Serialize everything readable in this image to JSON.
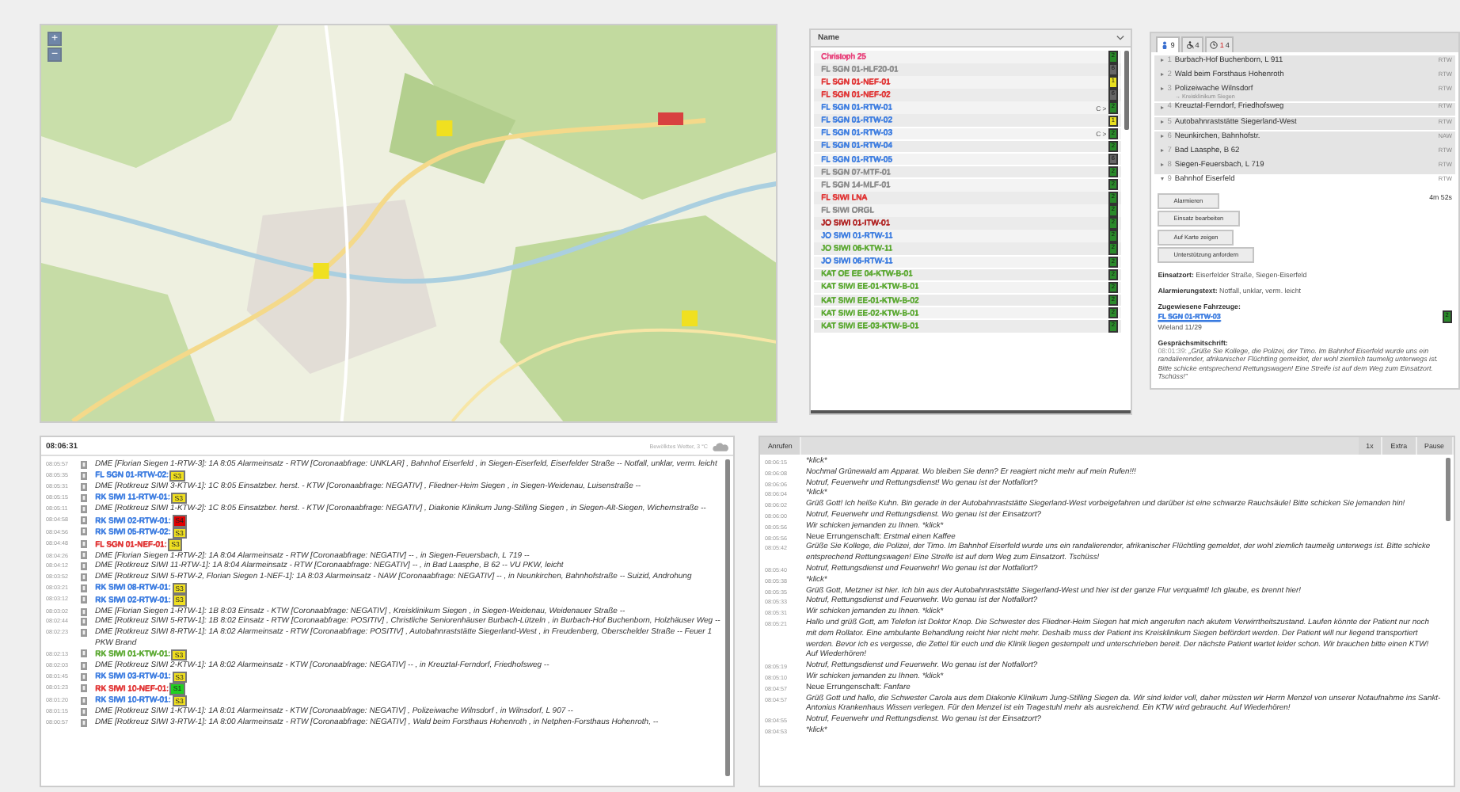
{
  "map": {
    "zoom_in": "+",
    "zoom_out": "−"
  },
  "vehicles": {
    "column": "Name",
    "items": [
      {
        "name": "Christoph 25",
        "color": "#e8407a",
        "status": {
          "text": "2",
          "color": "#2a8a2a"
        }
      },
      {
        "name": "FL SGN 01-HLF20-01",
        "color": "#8a8a8a",
        "status": {
          "text": "6",
          "color": "#666666"
        }
      },
      {
        "name": "FL SGN 01-NEF-01",
        "color": "#e03030",
        "status": {
          "text": "1",
          "color": "#e8e020"
        }
      },
      {
        "name": "FL SGN 01-NEF-02",
        "color": "#e03030",
        "status": {
          "text": "6",
          "color": "#666666"
        }
      },
      {
        "name": "FL SGN 01-RTW-01",
        "color": "#3a7be0",
        "marker": "C >",
        "status": {
          "text": "2",
          "color": "#2a8a2a"
        }
      },
      {
        "name": "FL SGN 01-RTW-02",
        "color": "#3a7be0",
        "status": {
          "text": "1",
          "color": "#e8e020"
        }
      },
      {
        "name": "FL SGN 01-RTW-03",
        "color": "#3a7be0",
        "marker": "C >",
        "status": {
          "text": "2",
          "color": "#2a8a2a"
        }
      },
      {
        "name": "FL SGN 01-RTW-04",
        "color": "#3a7be0",
        "status": {
          "text": "2",
          "color": "#2a8a2a"
        }
      },
      {
        "name": "FL SGN 01-RTW-05",
        "color": "#3a7be0",
        "status": {
          "text": "6",
          "color": "#666666"
        }
      },
      {
        "name": "FL SGN 07-MTF-01",
        "color": "#8a8a8a",
        "status": {
          "text": "2",
          "color": "#2a8a2a"
        }
      },
      {
        "name": "FL SGN 14-MLF-01",
        "color": "#8a8a8a",
        "status": {
          "text": "2",
          "color": "#2a8a2a"
        }
      },
      {
        "name": "FL SIWI LNA",
        "color": "#e03030",
        "status": {
          "text": "2",
          "color": "#2a8a2a"
        }
      },
      {
        "name": "FL SIWI ORGL",
        "color": "#8a8a8a",
        "status": {
          "text": "2",
          "color": "#2a8a2a"
        }
      },
      {
        "name": "JO SIWI 01-ITW-01",
        "color": "#b02020",
        "status": {
          "text": "2",
          "color": "#2a8a2a"
        }
      },
      {
        "name": "JO SIWI 01-RTW-11",
        "color": "#3a7be0",
        "status": {
          "text": "2",
          "color": "#2a8a2a"
        }
      },
      {
        "name": "JO SIWI 06-KTW-11",
        "color": "#5aa830",
        "status": {
          "text": "2",
          "color": "#2a8a2a"
        }
      },
      {
        "name": "JO SIWI 06-RTW-11",
        "color": "#3a7be0",
        "status": {
          "text": "2",
          "color": "#2a8a2a"
        }
      },
      {
        "name": "KAT OE EE 04-KTW-B-01",
        "color": "#5aa830",
        "status": {
          "text": "2",
          "color": "#2a8a2a"
        }
      },
      {
        "name": "KAT SIWI EE-01-KTW-B-01",
        "color": "#5aa830",
        "status": {
          "text": "2",
          "color": "#2a8a2a"
        }
      },
      {
        "name": "KAT SIWI EE-01-KTW-B-02",
        "color": "#5aa830",
        "status": {
          "text": "2",
          "color": "#2a8a2a"
        }
      },
      {
        "name": "KAT SIWI EE-02-KTW-B-01",
        "color": "#5aa830",
        "status": {
          "text": "2",
          "color": "#2a8a2a"
        }
      },
      {
        "name": "KAT SIWI EE-03-KTW-B-01",
        "color": "#5aa830",
        "status": {
          "text": "2",
          "color": "#2a8a2a"
        }
      }
    ]
  },
  "incidents": {
    "tabs": [
      {
        "kind": "calls",
        "label": "9",
        "selected": true
      },
      {
        "kind": "vehicles",
        "label": "4",
        "selected": false
      },
      {
        "kind": "timer",
        "label": "1",
        "label_2": "4",
        "selected": false
      }
    ],
    "items": [
      {
        "number": "1",
        "title": "Burbach-Hof Buchenborn, L 911",
        "type": "RTW",
        "expanded": false
      },
      {
        "number": "2",
        "title": "Wald beim Forsthaus Hohenroth",
        "type": "RTW",
        "expanded": false
      },
      {
        "number": "3",
        "title": "Polizeiwache Wilnsdorf",
        "subtitle": "→ Kreisklinikum Siegen",
        "type": "RTW",
        "expanded": false
      },
      {
        "number": "4",
        "title": "Kreuztal-Ferndorf, Friedhofsweg",
        "type": "RTW",
        "expanded": false
      },
      {
        "number": "5",
        "title": "Autobahnraststätte Siegerland-West",
        "type": "RTW",
        "expanded": false
      },
      {
        "number": "6",
        "title": "Neunkirchen, Bahnhofstr.",
        "type": "NAW",
        "expanded": false
      },
      {
        "number": "7",
        "title": "Bad Laasphe, B 62",
        "type": "RTW",
        "expanded": false
      },
      {
        "number": "8",
        "title": "Siegen-Feuersbach, L 719",
        "type": "RTW",
        "expanded": false
      },
      {
        "number": "9",
        "title": "Bahnhof Eiserfeld",
        "type": "RTW",
        "expanded": true
      }
    ],
    "detail": {
      "buttons": [
        "Alarmieren",
        "Einsatz bearbeiten",
        "Auf Karte zeigen",
        "Unterstützung anfordern"
      ],
      "timer": "4m 52s",
      "location_label": "Einsatzort:",
      "location": "Eiserfelder Straße, Siegen-Eiserfeld",
      "alarm_label": "Alarmierungstext:",
      "alarm": "Notfall, unklar, verm. leicht",
      "vehicles_label": "Zugewiesene Fahrzeuge:",
      "vehicle": {
        "name": "FL SGN 01-RTW-03",
        "color": "#3a7be0",
        "status": {
          "text": "2",
          "color": "#2a8a2a"
        }
      },
      "vehicle_note": "Wieland 11/29",
      "transcript_label": "Gesprächsmitschrift:",
      "transcript_time": "08:01:39:",
      "transcript": "„Grüße Sie Kollege, die Polizei, der Timo. Im Bahnhof Eiserfeld wurde uns ein randalierender, afrikanischer Flüchtling gemeldet, der wohl ziemlich taumelig unterwegs ist. Bitte schicke entsprechend Rettungswagen! Eine Streife ist auf dem Weg zum Einsatzort. Tschüss!\""
    }
  },
  "radio_log": {
    "time": "08:06:31",
    "weather": "Bewölktes Wetter, 3 °C",
    "entries": [
      {
        "time": "08:05:57",
        "kind": "dme",
        "text": "DME [Florian Siegen 1-RTW-3]: 1A 8:05 Alarmeinsatz - RTW [Coronaabfrage: UNKLAR] , Bahnhof Eiserfeld , in Siegen-Eiserfeld, Eiserfelder Straße -- Notfall, unklar, verm. leicht"
      },
      {
        "time": "08:05:35",
        "kind": "status",
        "vehicle": "FL SGN 01-RTW-02:",
        "color": "#3a7be0",
        "status": {
          "text": "S3",
          "color": "#f0e020"
        }
      },
      {
        "time": "08:05:31",
        "kind": "dme",
        "text": "DME [Rotkreuz SIWI 3-KTW-1]: 1C 8:05 Einsatzber. herst. - KTW [Coronaabfrage: NEGATIV] , Fliedner-Heim Siegen , in Siegen-Weidenau, Luisenstraße --"
      },
      {
        "time": "08:05:15",
        "kind": "status",
        "vehicle": "RK SIWI 11-RTW-01:",
        "color": "#3a7be0",
        "status": {
          "text": "S3",
          "color": "#f0e020"
        }
      },
      {
        "time": "08:05:11",
        "kind": "dme",
        "text": "DME [Rotkreuz SIWI 1-KTW-2]: 1C 8:05 Einsatzber. herst. - KTW [Coronaabfrage: NEGATIV] , Diakonie Klinikum Jung-Stilling Siegen , in Siegen-Alt-Siegen, Wichernstraße --"
      },
      {
        "time": "08:04:58",
        "kind": "status",
        "vehicle": "RK SIWI 02-RTW-01:",
        "color": "#3a7be0",
        "status": {
          "text": "S4",
          "color": "#e00000"
        }
      },
      {
        "time": "08:04:56",
        "kind": "status",
        "vehicle": "RK SIWI 05-RTW-02:",
        "color": "#3a7be0",
        "status": {
          "text": "S3",
          "color": "#f0e020"
        }
      },
      {
        "time": "08:04:48",
        "kind": "status",
        "vehicle": "FL SGN 01-NEF-01:",
        "color": "#e03030",
        "status": {
          "text": "S3",
          "color": "#f0e020"
        }
      },
      {
        "time": "08:04:26",
        "kind": "dme",
        "text": "DME [Florian Siegen 1-RTW-2]: 1A 8:04 Alarmeinsatz - RTW [Coronaabfrage: NEGATIV] -- , in Siegen-Feuersbach, L 719 --"
      },
      {
        "time": "08:04:12",
        "kind": "dme",
        "text": "DME [Rotkreuz SIWI 11-RTW-1]: 1A 8:04 Alarmeinsatz - RTW [Coronaabfrage: NEGATIV] -- , in Bad Laasphe, B 62 -- VU PKW, leicht"
      },
      {
        "time": "08:03:52",
        "kind": "dme",
        "text": "DME [Rotkreuz SIWI 5-RTW-2, Florian Siegen 1-NEF-1]: 1A 8:03 Alarmeinsatz - NAW [Coronaabfrage: NEGATIV] -- , in Neunkirchen, Bahnhofstraße -- Suizid, Androhung"
      },
      {
        "time": "08:03:21",
        "kind": "status",
        "vehicle": "RK SIWI 08-RTW-01:",
        "color": "#3a7be0",
        "status": {
          "text": "S3",
          "color": "#f0e020"
        }
      },
      {
        "time": "08:03:12",
        "kind": "status",
        "vehicle": "RK SIWI 02-RTW-01:",
        "color": "#3a7be0",
        "status": {
          "text": "S3",
          "color": "#f0e020"
        }
      },
      {
        "time": "08:03:02",
        "kind": "dme",
        "text": "DME [Florian Siegen 1-RTW-1]: 1B 8:03 Einsatz - KTW [Coronaabfrage: NEGATIV] , Kreisklinikum Siegen , in Siegen-Weidenau, Weidenauer Straße --"
      },
      {
        "time": "08:02:44",
        "kind": "dme",
        "text": "DME [Rotkreuz SIWI 5-RTW-1]: 1B 8:02 Einsatz - RTW [Coronaabfrage: POSITIV] , Christliche Seniorenhäuser Burbach-Lützeln , in Burbach-Hof Buchenborn, Holzhäuser Weg --"
      },
      {
        "time": "08:02:23",
        "kind": "dme",
        "text": "DME [Rotkreuz SIWI 8-RTW-1]: 1A 8:02 Alarmeinsatz - RTW [Coronaabfrage: POSITIV] , Autobahnraststätte Siegerland-West , in Freudenberg, Oberschelder Straße -- Feuer 1 PKW Brand"
      },
      {
        "time": "08:02:13",
        "kind": "status",
        "vehicle": "RK SIWI 01-KTW-01:",
        "color": "#5aa830",
        "status": {
          "text": "S3",
          "color": "#f0e020"
        }
      },
      {
        "time": "08:02:03",
        "kind": "dme",
        "text": "DME [Rotkreuz SIWI 2-KTW-1]: 1A 8:02 Alarmeinsatz - KTW [Coronaabfrage: NEGATIV] -- , in Kreuztal-Ferndorf, Friedhofsweg --"
      },
      {
        "time": "08:01:45",
        "kind": "status",
        "vehicle": "RK SIWI 03-RTW-01:",
        "color": "#3a7be0",
        "status": {
          "text": "S3",
          "color": "#f0e020"
        }
      },
      {
        "time": "08:01:23",
        "kind": "status",
        "vehicle": "RK SIWI 10-NEF-01:",
        "color": "#e03030",
        "status": {
          "text": "S1",
          "color": "#20d020"
        }
      },
      {
        "time": "08:01:20",
        "kind": "status",
        "vehicle": "RK SIWI 10-RTW-01:",
        "color": "#3a7be0",
        "status": {
          "text": "S3",
          "color": "#f0e020"
        }
      },
      {
        "time": "08:01:15",
        "kind": "dme",
        "text": "DME [Rotkreuz SIWI 1-KTW-1]: 1A 8:01 Alarmeinsatz - KTW [Coronaabfrage: NEGATIV] , Polizeiwache Wilnsdorf , in Wilnsdorf, L 907 --"
      },
      {
        "time": "08:00:57",
        "kind": "dme",
        "text": "DME [Rotkreuz SIWI 3-RTW-1]: 1A 8:00 Alarmeinsatz - RTW [Coronaabfrage: NEGATIV] , Wald beim Forsthaus Hohenroth , in Netphen-Forsthaus Hohenroth, --"
      }
    ]
  },
  "call_log": {
    "call_button": "Anrufen",
    "speed_buttons": [
      "1x",
      "Extra",
      "Pause"
    ],
    "entries": [
      {
        "time": "08:06:15",
        "kind": "call",
        "text": "*klick*"
      },
      {
        "time": "08:06:08",
        "kind": "call",
        "text": "Nochmal Grünewald am Apparat. Wo bleiben Sie denn? Er reagiert nicht mehr auf mein Rufen!!!"
      },
      {
        "time": "08:06:06",
        "kind": "call",
        "text": "Notruf, Feuerwehr und Rettungsdienst! Wo genau ist der Notfallort?"
      },
      {
        "time": "08:06:04",
        "kind": "call",
        "text": "*klick*"
      },
      {
        "time": "08:06:02",
        "kind": "call",
        "text": "Grüß Gott! Ich heiße Kuhn. Bin gerade in der Autobahnraststätte Siegerland-West vorbeigefahren und darüber ist eine schwarze Rauchsäule! Bitte schicken Sie jemanden hin!"
      },
      {
        "time": "08:06:00",
        "kind": "call",
        "text": "Notruf, Feuerwehr und Rettungsdienst. Wo genau ist der Einsatzort?"
      },
      {
        "time": "08:05:56",
        "kind": "call",
        "text": "Wir schicken jemanden zu Ihnen. *klick*"
      },
      {
        "time": "08:05:56",
        "kind": "achievement",
        "text": "Neue Errungenschaft: *Erstmal einen Kaffee*"
      },
      {
        "time": "08:05:42",
        "kind": "call",
        "text": "Grüße Sie Kollege, die Polizei, der Timo. Im Bahnhof Eiserfeld wurde uns ein randalierender, afrikanischer Flüchtling gemeldet, der wohl ziemlich taumelig unterwegs ist. Bitte schicke entsprechend Rettungswagen! Eine Streife ist auf dem Weg zum Einsatzort. Tschüss!"
      },
      {
        "time": "08:05:40",
        "kind": "call",
        "text": "Notruf, Rettungsdienst und Feuerwehr! Wo genau ist der Notfallort?"
      },
      {
        "time": "08:05:38",
        "kind": "call",
        "text": "*klick*"
      },
      {
        "time": "08:05:35",
        "kind": "call",
        "text": "Grüß Gott, Metzner ist hier. Ich bin aus der Autobahnraststätte Siegerland-West und hier ist der ganze Flur verqualmt! Ich glaube, es brennt hier!"
      },
      {
        "time": "08:05:33",
        "kind": "call",
        "text": "Notruf, Rettungsdienst und Feuerwehr. Wo genau ist der Notfallort?"
      },
      {
        "time": "08:05:31",
        "kind": "call",
        "text": "Wir schicken jemanden zu Ihnen. *klick*"
      },
      {
        "time": "08:05:21",
        "kind": "call",
        "text": "Hallo und grüß Gott, am Telefon ist Doktor Knop. Die Schwester des Fliedner-Heim Siegen hat mich angerufen nach akutem Verwirrtheitszustand. Laufen könnte der Patient nur noch mit dem Rollator. Eine ambulante Behandlung reicht hier nicht mehr. Deshalb muss der Patient ins Kreisklinikum Siegen befördert werden. Der Patient will nur liegend transportiert werden. Bevor ich es vergesse, die Zettel für euch und die Klinik liegen gestempelt und unterschrieben bereit. Der nächste Patient wartet leider schon. Wir brauchen bitte einen KTW! Auf Wiederhören!"
      },
      {
        "time": "08:05:19",
        "kind": "call",
        "text": "Notruf, Rettungsdienst und Feuerwehr. Wo genau ist der Notfallort?"
      },
      {
        "time": "08:05:10",
        "kind": "call",
        "text": "Wir schicken jemanden zu Ihnen. *klick*"
      },
      {
        "time": "08:04:57",
        "kind": "achievement",
        "text": "Neue Errungenschaft: *Fanfare*"
      },
      {
        "time": "08:04:57",
        "kind": "call",
        "text": "Grüß Gott und hallo, die Schwester Carola aus dem Diakonie Klinikum Jung-Stilling Siegen da. Wir sind leider voll, daher müssten wir Herrn Menzel von unserer Notaufnahme ins Sankt-Antonius Krankenhaus Wissen verlegen. Für den Menzel ist ein Tragestuhl mehr als ausreichend. Ein KTW wird gebraucht. Auf Wiederhören!"
      },
      {
        "time": "08:04:55",
        "kind": "call",
        "text": "Notruf, Feuerwehr und Rettungsdienst. Wo genau ist der Einsatzort?"
      },
      {
        "time": "08:04:53",
        "kind": "call",
        "text": "*klick*"
      }
    ]
  }
}
